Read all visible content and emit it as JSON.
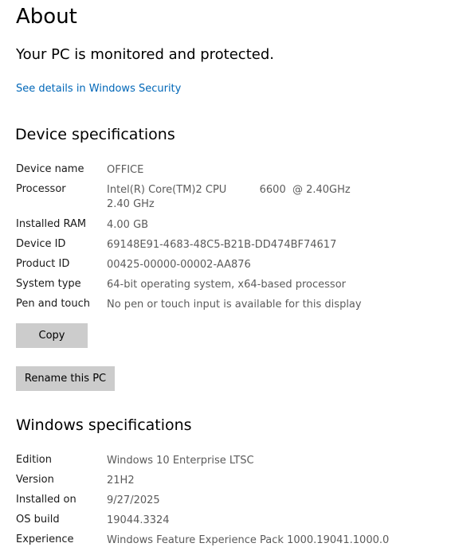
{
  "page": {
    "title": "About",
    "status": "Your PC is monitored and protected.",
    "security_link": "See details in Windows Security"
  },
  "device_specs": {
    "heading": "Device specifications",
    "rows": [
      {
        "label": "Device name",
        "value": "OFFICE"
      },
      {
        "label": "Processor",
        "value": "Intel(R) Core(TM)2 CPU          6600  @ 2.40GHz   2.40 GHz"
      },
      {
        "label": "Installed RAM",
        "value": "4.00 GB"
      },
      {
        "label": "Device ID",
        "value": "69148E91-4683-48C5-B21B-DD474BF74617"
      },
      {
        "label": "Product ID",
        "value": "00425-00000-00002-AA876"
      },
      {
        "label": "System type",
        "value": "64-bit operating system, x64-based processor"
      },
      {
        "label": "Pen and touch",
        "value": "No pen or touch input is available for this display"
      }
    ],
    "copy_label": "Copy",
    "rename_label": "Rename this PC"
  },
  "windows_specs": {
    "heading": "Windows specifications",
    "rows": [
      {
        "label": "Edition",
        "value": "Windows 10 Enterprise LTSC"
      },
      {
        "label": "Version",
        "value": "21H2"
      },
      {
        "label": "Installed on",
        "value": "9/27/2025"
      },
      {
        "label": "OS build",
        "value": "19044.3324"
      },
      {
        "label": "Experience",
        "value": "Windows Feature Experience Pack 1000.19041.1000.0"
      }
    ]
  },
  "colors": {
    "link": "#0067b8",
    "button_bg": "#cccccc",
    "value_text": "#5b5b5b"
  }
}
